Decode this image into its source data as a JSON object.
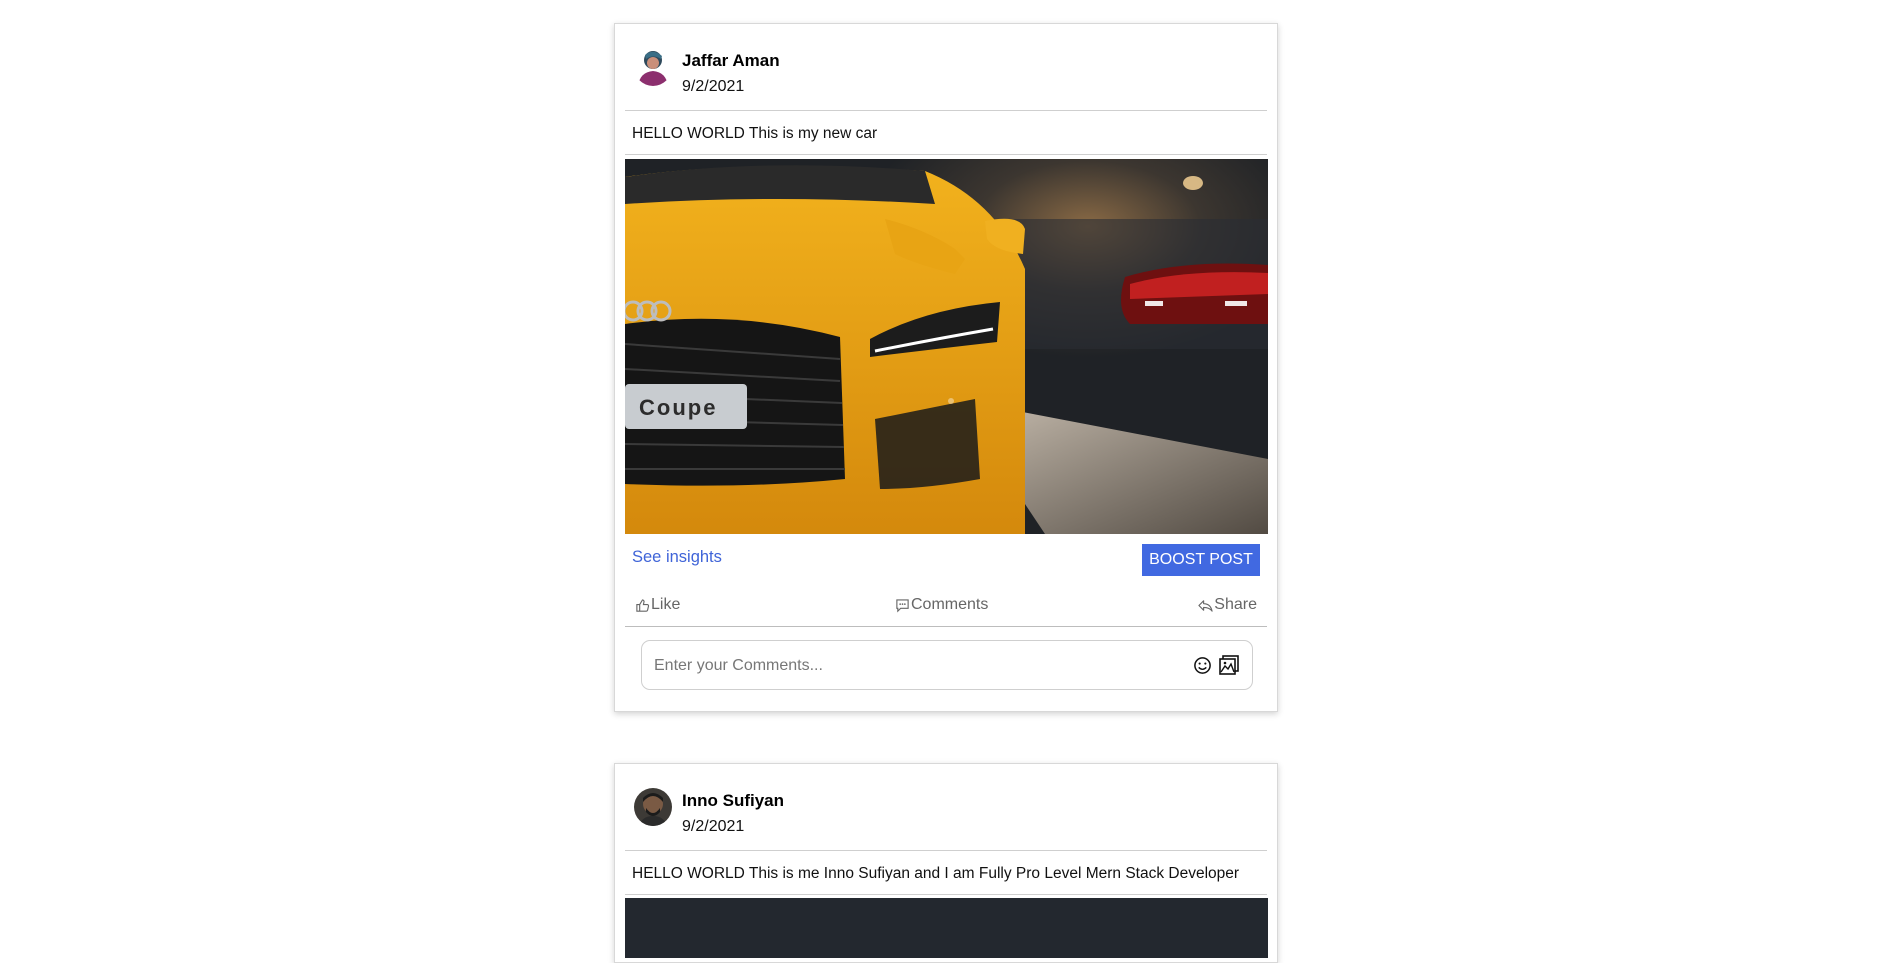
{
  "posts": [
    {
      "author": "Jaffar Aman",
      "date": "9/2/2021",
      "text": "HELLO WORLD This is my new car",
      "image_caption": "Coupe",
      "insights_label": "See insights",
      "boost_label": "BOOST POST",
      "actions": {
        "like": "Like",
        "comments": "Comments",
        "share": "Share"
      },
      "comment_placeholder": "Enter your Comments...",
      "icons": [
        "like-icon",
        "comments-icon",
        "share-icon",
        "emoji-icon",
        "image-upload-icon"
      ]
    },
    {
      "author": "Inno Sufiyan",
      "date": "9/2/2021",
      "text": "HELLO WORLD This is me Inno Sufiyan and I am Fully Pro Level Mern Stack Developer"
    }
  ],
  "colors": {
    "accent": "#4169e1",
    "link": "#3f64d8",
    "car": "#f0a91a"
  }
}
